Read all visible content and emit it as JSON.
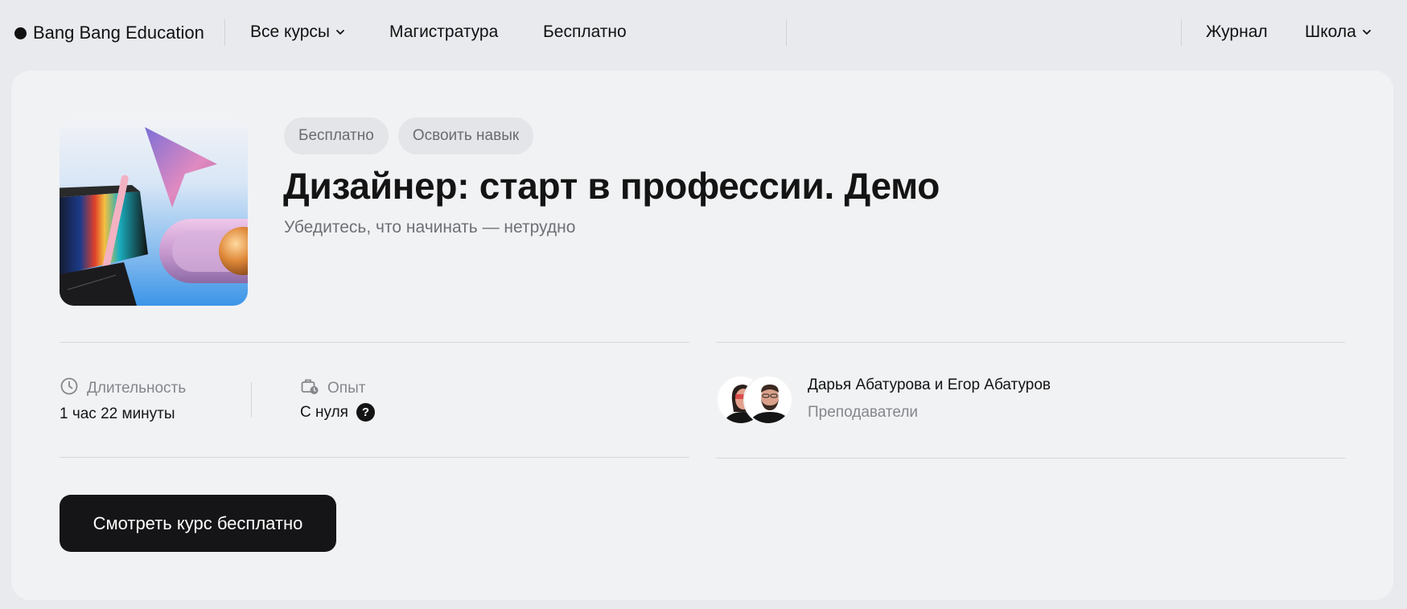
{
  "nav": {
    "logo": "Bang Bang Education",
    "items": [
      {
        "label": "Все курсы",
        "dropdown": true
      },
      {
        "label": "Магистратура",
        "dropdown": false
      },
      {
        "label": "Бесплатно",
        "dropdown": false
      }
    ],
    "right_items": [
      {
        "label": "Журнал",
        "dropdown": false
      },
      {
        "label": "Школа",
        "dropdown": true
      }
    ]
  },
  "course": {
    "tags": [
      "Бесплатно",
      "Освоить навык"
    ],
    "title": "Дизайнер: старт в профессии. Демо",
    "subtitle": "Убедитесь, что начинать — нетрудно",
    "cover_icon": "abstract-3d-cover-image"
  },
  "meta": {
    "duration": {
      "label": "Длительность",
      "value": "1 час 22 минуты",
      "icon": "clock-icon"
    },
    "experience": {
      "label": "Опыт",
      "value": "С нуля",
      "icon": "briefcase-clock-icon",
      "help": "?"
    }
  },
  "teachers": {
    "names": "Дарья Абатурова и Егор Абатуров",
    "role": "Преподаватели"
  },
  "cta": {
    "label": "Смотреть курс бесплатно"
  },
  "colors": {
    "page_bg": "#e9eaee",
    "card_bg": "#f1f2f4",
    "tag_bg": "#e4e5e8",
    "button_bg": "#151517",
    "muted_text": "#85868b"
  }
}
